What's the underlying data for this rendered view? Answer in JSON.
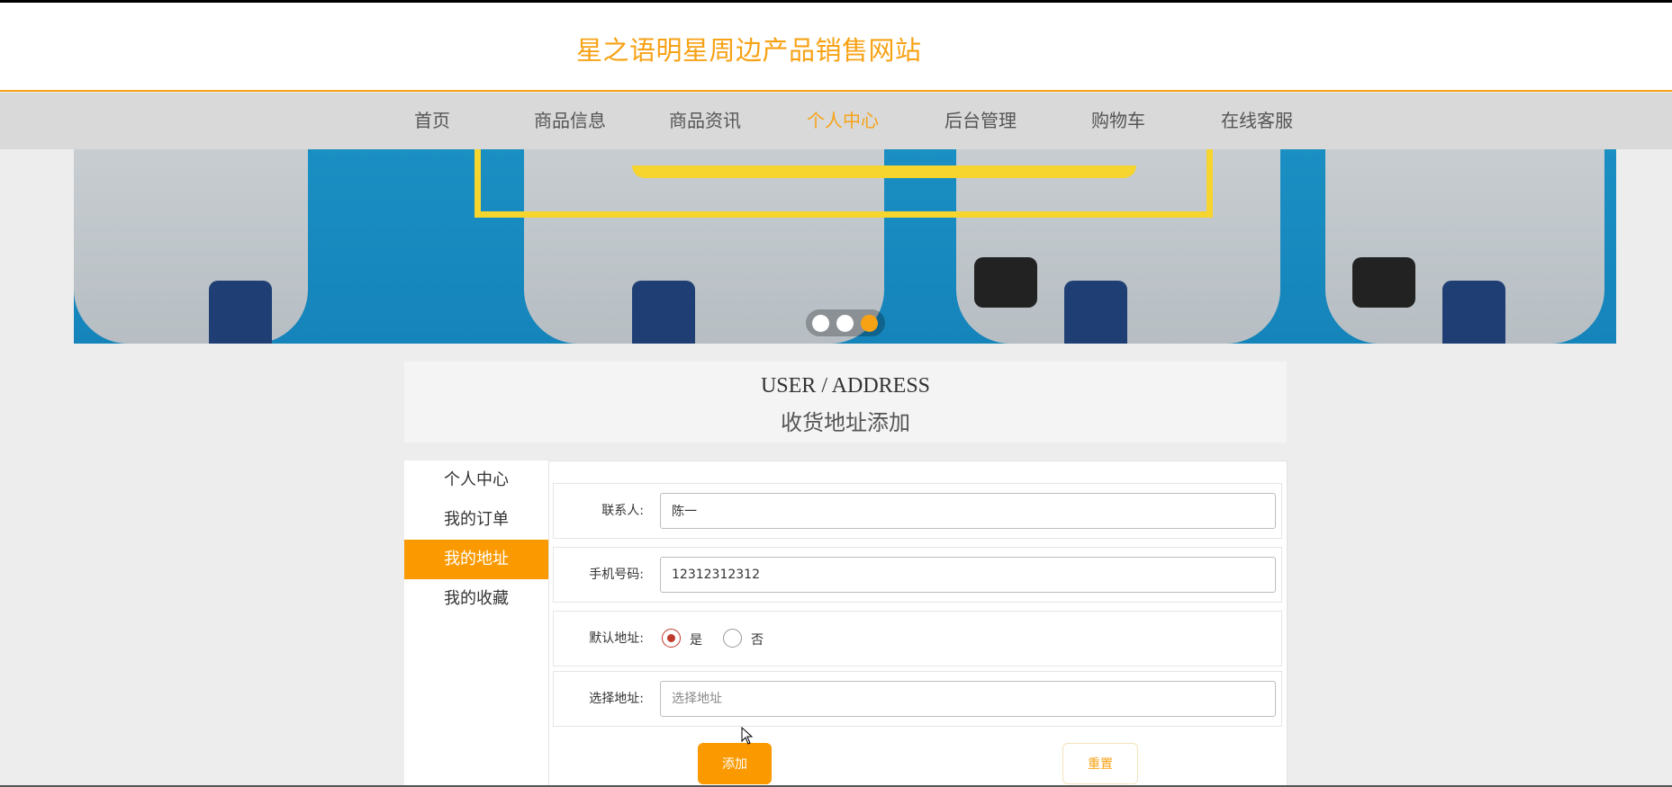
{
  "header": {
    "site_title": "星之语明星周边产品销售网站"
  },
  "nav": {
    "items": [
      {
        "label": "首页"
      },
      {
        "label": "商品信息"
      },
      {
        "label": "商品资讯"
      },
      {
        "label": "个人中心",
        "active": true
      },
      {
        "label": "后台管理"
      },
      {
        "label": "购物车"
      },
      {
        "label": "在线客服"
      }
    ]
  },
  "banner": {
    "slides_count": 3,
    "active_slide": 3
  },
  "page_title": {
    "en": "USER / ADDRESS",
    "cn": "收货地址添加"
  },
  "sidebar": {
    "items": [
      {
        "label": "个人中心"
      },
      {
        "label": "我的订单"
      },
      {
        "label": "我的地址",
        "active": true
      },
      {
        "label": "我的收藏"
      }
    ]
  },
  "form": {
    "contact": {
      "label": "联系人:",
      "value": "陈一"
    },
    "phone": {
      "label": "手机号码:",
      "value": "12312312312"
    },
    "default_address": {
      "label": "默认地址:",
      "options": [
        "是",
        "否"
      ],
      "selected": "是"
    },
    "address": {
      "label": "选择地址:",
      "placeholder": "选择地址"
    },
    "add_button": "添加",
    "reset_button": "重置"
  },
  "colors": {
    "accent": "#fb9a00",
    "title": "#f7a215",
    "nav_bg": "#d9d9d9"
  }
}
